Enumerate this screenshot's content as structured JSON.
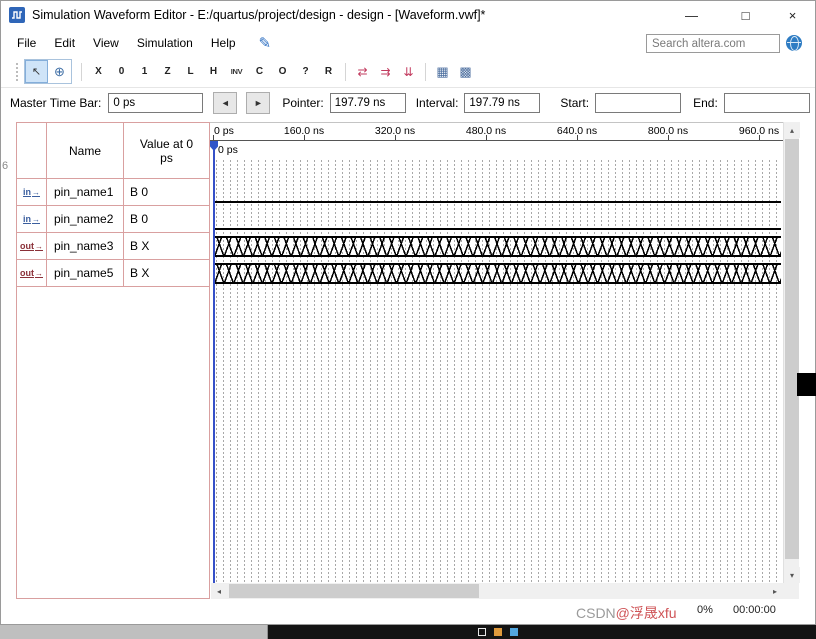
{
  "window": {
    "title": "Simulation Waveform Editor - E:/quartus/project/design - design - [Waveform.vwf]*",
    "minimize": "—",
    "maximize": "□",
    "close": "×"
  },
  "menu": {
    "items": [
      "File",
      "Edit",
      "View",
      "Simulation",
      "Help"
    ]
  },
  "search": {
    "placeholder": "Search altera.com",
    "value": ""
  },
  "toolbar": {
    "buttons": [
      {
        "name": "select-tool",
        "glyph": "↖"
      },
      {
        "name": "zoom-tool",
        "glyph": "⊕"
      },
      {
        "name": "force-uncertain",
        "glyph": "X"
      },
      {
        "name": "force-low",
        "glyph": "0"
      },
      {
        "name": "force-high",
        "glyph": "1"
      },
      {
        "name": "force-high-impedance",
        "glyph": "Z"
      },
      {
        "name": "force-weak-low",
        "glyph": "L"
      },
      {
        "name": "force-weak-high",
        "glyph": "H"
      },
      {
        "name": "invert",
        "glyph": "INV"
      },
      {
        "name": "count-value",
        "glyph": "C"
      },
      {
        "name": "overwrite-clock",
        "glyph": "O"
      },
      {
        "name": "arbitrary-value",
        "glyph": "?"
      },
      {
        "name": "random-values",
        "glyph": "R"
      },
      {
        "name": "snap-to-grid",
        "glyph": "⇄"
      },
      {
        "name": "snap-to-transition",
        "glyph": "⇉"
      },
      {
        "name": "sort-order",
        "glyph": "⇊"
      },
      {
        "name": "show-grid",
        "glyph": "▦"
      },
      {
        "name": "time-bar-settings",
        "glyph": "▩"
      }
    ]
  },
  "timebar": {
    "master_label": "Master Time Bar:",
    "master_value": "0 ps",
    "back": "◄",
    "forward": "►",
    "pointer_label": "Pointer:",
    "pointer_value": "197.79 ns",
    "interval_label": "Interval:",
    "interval_value": "197.79 ns",
    "start_label": "Start:",
    "start_value": "",
    "end_label": "End:",
    "end_value": ""
  },
  "signals": {
    "headers": {
      "name": "Name",
      "value": "Value at 0 ps"
    },
    "rows": [
      {
        "dir": "in",
        "name": "pin_name1",
        "value": "B 0",
        "wave": "low"
      },
      {
        "dir": "in",
        "name": "pin_name2",
        "value": "B 0",
        "wave": "low"
      },
      {
        "dir": "out",
        "name": "pin_name3",
        "value": "B X",
        "wave": "unknown"
      },
      {
        "dir": "out",
        "name": "pin_name5",
        "value": "B X",
        "wave": "unknown"
      }
    ]
  },
  "ruler": {
    "ticks": [
      "0 ps",
      "160.0 ns",
      "320.0 ns",
      "480.0 ns",
      "640.0 ns",
      "800.0 ns",
      "960.0 ns"
    ],
    "marker": "0 ps"
  },
  "status": {
    "progress": "0%",
    "time": "00:00:00"
  },
  "watermark": {
    "prefix": "CSDN",
    "suffix": "@浮晟xfu"
  },
  "artifacts": {
    "line_number": "6"
  },
  "colors": {
    "accent": "#3550c8",
    "grid_border": "#d9a0a0",
    "unknown_fill": "#000000"
  }
}
